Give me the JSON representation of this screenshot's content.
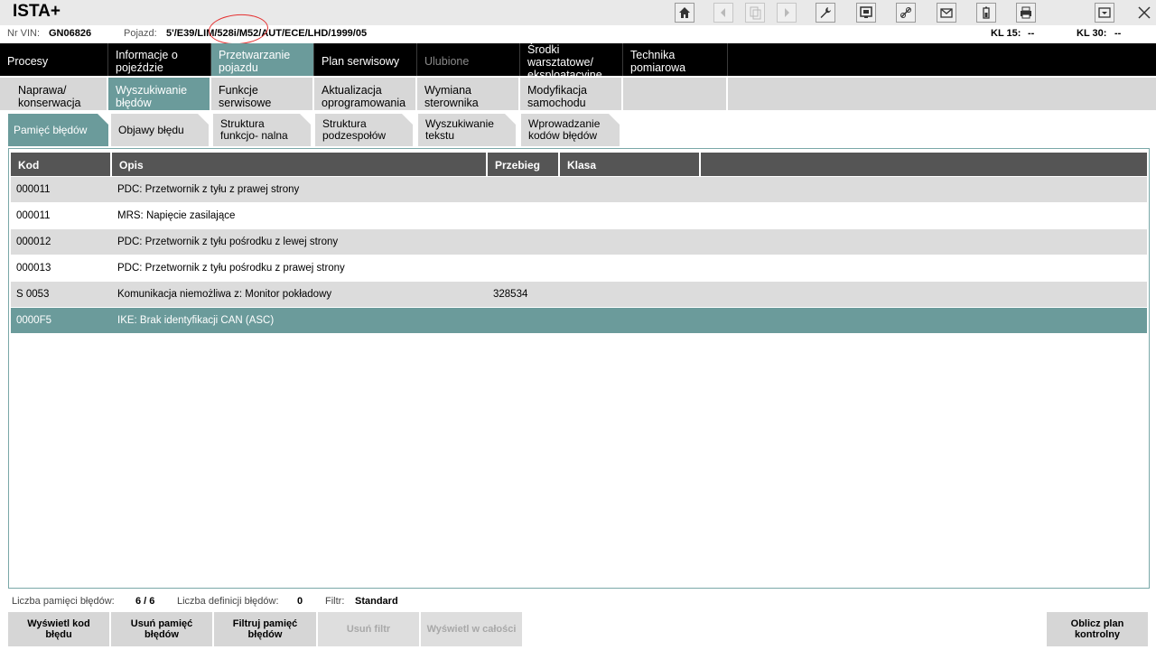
{
  "app": {
    "title": "ISTA+"
  },
  "toolbar": {
    "icons": [
      {
        "name": "home-icon",
        "glyph": "⌂"
      },
      {
        "name": "back-icon",
        "glyph": "◀"
      },
      {
        "name": "copy-icon",
        "glyph": "❐"
      },
      {
        "name": "forward-icon",
        "glyph": "▶"
      },
      {
        "name": "wrench-icon",
        "glyph": "🔧"
      },
      {
        "name": "vehicle-info-icon",
        "glyph": "▣"
      },
      {
        "name": "connection-icon",
        "glyph": "⚷"
      },
      {
        "name": "mail-icon",
        "glyph": "✉"
      },
      {
        "name": "battery-icon",
        "glyph": "▮"
      },
      {
        "name": "print-icon",
        "glyph": "⎙"
      },
      {
        "name": "minimize-icon",
        "glyph": "▭"
      },
      {
        "name": "close-icon",
        "glyph": "✕"
      }
    ]
  },
  "info": {
    "vin_label": "Nr VIN:",
    "vin_value": "GN06826",
    "vehicle_label": "Pojazd:",
    "vehicle_value": "5'/E39/LIM/528i/M52/AUT/ECE/LHD/1999/05",
    "kl15_label": "KL 15:",
    "kl15_value": "--",
    "kl30_label": "KL 30:",
    "kl30_value": "--"
  },
  "mainnav": [
    {
      "label": "Procesy"
    },
    {
      "label": "Informacje o pojeździe"
    },
    {
      "label": "Przetwarzanie pojazdu"
    },
    {
      "label": "Plan serwisowy"
    },
    {
      "label": "Ulubione"
    },
    {
      "label": "Środki warsztatowe/ eksploatacyjne"
    },
    {
      "label": "Technika pomiarowa"
    }
  ],
  "subnav": [
    {
      "label": "Naprawa/ konserwacja"
    },
    {
      "label": "Wyszukiwanie błędów"
    },
    {
      "label": "Funkcje serwisowe"
    },
    {
      "label": "Aktualizacja oprogramowania"
    },
    {
      "label": "Wymiana sterownika"
    },
    {
      "label": "Modyfikacja samochodu"
    }
  ],
  "tabs": [
    {
      "label": "Pamięć błędów"
    },
    {
      "label": "Objawy błędu"
    },
    {
      "label": "Struktura funkcjo- nalna"
    },
    {
      "label": "Struktura podzespołów"
    },
    {
      "label": "Wyszukiwanie tekstu"
    },
    {
      "label": "Wprowadzanie kodów błędów"
    }
  ],
  "table": {
    "columns": [
      "Kod",
      "Opis",
      "Przebieg",
      "Klasa"
    ],
    "rows": [
      {
        "kod": "000011",
        "opis": "PDC: Przetwornik z tyłu z prawej strony",
        "przebieg": "",
        "klasa": ""
      },
      {
        "kod": "000011",
        "opis": "MRS: Napięcie zasilające",
        "przebieg": "",
        "klasa": ""
      },
      {
        "kod": "000012",
        "opis": "PDC: Przetwornik z tyłu pośrodku z lewej strony",
        "przebieg": "",
        "klasa": ""
      },
      {
        "kod": "000013",
        "opis": "PDC: Przetwornik z tyłu pośrodku z prawej strony",
        "przebieg": "",
        "klasa": ""
      },
      {
        "kod": "S 0053",
        "opis": "Komunikacja niemożliwa z: Monitor pokładowy",
        "przebieg": "328534",
        "klasa": ""
      },
      {
        "kod": "0000F5",
        "opis": "IKE: Brak identyfikacji CAN (ASC)",
        "przebieg": "",
        "klasa": ""
      }
    ]
  },
  "status": {
    "memory_label": "Liczba pamięci błędów:",
    "memory_value": "6 / 6",
    "defs_label": "Liczba definicji błędów:",
    "defs_value": "0",
    "filter_label": "Filtr:",
    "filter_value": "Standard"
  },
  "buttons": {
    "show_code": "Wyświetl kod błędu",
    "delete_memory": "Usuń pamięć błędów",
    "filter_memory": "Filtruj pamięć błędów",
    "remove_filter": "Usuń filtr",
    "show_all": "Wyświetl w całości",
    "calc_plan": "Oblicz plan kontrolny"
  },
  "colors": {
    "accent": "#6b9b9b",
    "header": "#555555",
    "nav": "#000000"
  }
}
